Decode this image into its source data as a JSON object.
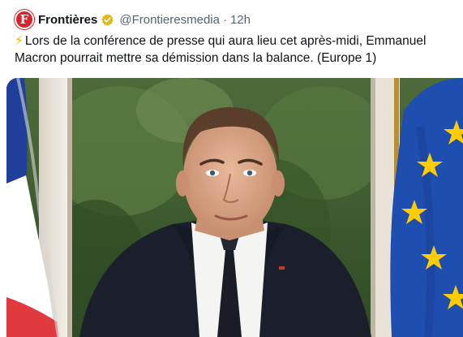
{
  "tweet": {
    "author_name": "Frontières",
    "author_handle": "@Frontieresmedia",
    "separator": "·",
    "time": "12h",
    "avatar_letter": "F",
    "bolt": "⚡",
    "text": "Lors de la conférence de presse qui aura lieu cet après-midi, Emmanuel Macron pourrait mettre sa démission dans la balance. (Europe 1)"
  },
  "icons": {
    "avatar": "frontieres-logo",
    "verified": "gold-verified-badge",
    "emoji": "high-voltage-emoji"
  },
  "colors": {
    "accent_red": "#d8232a",
    "verified_gold": "#e2b719",
    "text_primary": "#0f1419",
    "text_secondary": "#536471",
    "eu_blue": "#1e4fb0",
    "eu_star": "#ffcc00"
  }
}
